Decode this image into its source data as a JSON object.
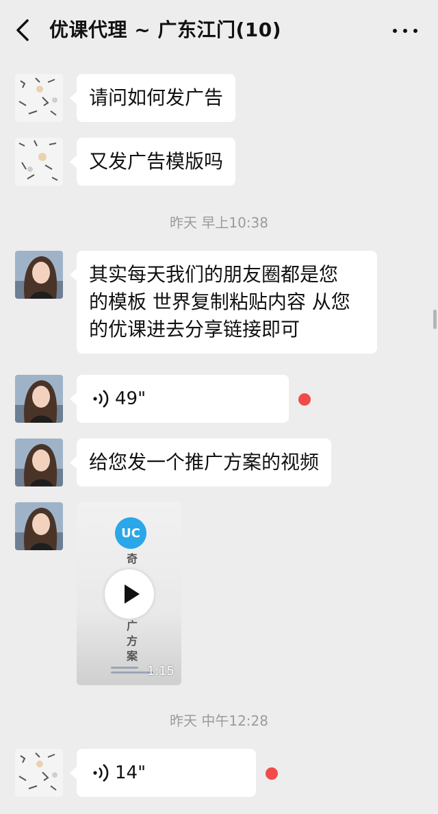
{
  "header": {
    "title": "优课代理 ~ 广东江门(10)",
    "back_icon": "chevron-left-icon",
    "more_icon": "more-dots-icon"
  },
  "messages": [
    {
      "type": "text",
      "sender": "member-sketch",
      "text": "请问如何发广告"
    },
    {
      "type": "text",
      "sender": "member-sketch",
      "text": "又发广告模版吗"
    },
    {
      "type": "timestamp",
      "text": "昨天 早上10:38"
    },
    {
      "type": "text",
      "sender": "member-photo",
      "lines": [
        "其实每天我们的朋友圈都是您",
        "的模板 世界复制粘贴内容 从您",
        "的优课进去分享链接即可"
      ]
    },
    {
      "type": "voice",
      "sender": "member-photo",
      "duration": "49\"",
      "unread": true
    },
    {
      "type": "text",
      "sender": "member-photo",
      "text": "给您发一个推广方案的视频"
    },
    {
      "type": "video",
      "sender": "member-photo",
      "duration": "1:15",
      "logo_text": "UC",
      "vertical_text_top": [
        "奇"
      ],
      "vertical_text_bottom": [
        "广",
        "方",
        "案"
      ]
    },
    {
      "type": "timestamp",
      "text": "昨天 中午12:28"
    },
    {
      "type": "voice",
      "sender": "member-sketch",
      "duration": "14\"",
      "unread": true
    }
  ],
  "colors": {
    "background": "#ededed",
    "bubble": "#ffffff",
    "timestamp_text": "#9b9b9b",
    "unread_dot": "#f04a4a",
    "logo_blue": "#2aa7e8"
  }
}
